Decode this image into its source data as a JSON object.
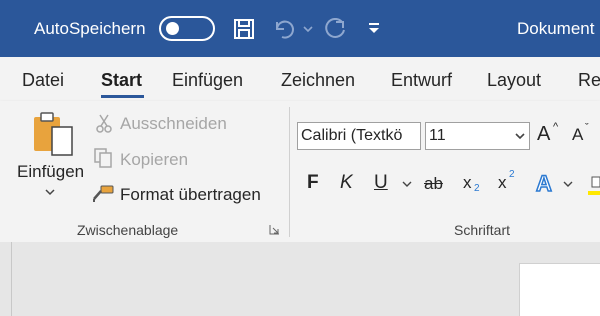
{
  "titlebar": {
    "autosave_label": "AutoSpeichern",
    "autosave_state": "off",
    "document_title": "Dokument"
  },
  "tabs": [
    {
      "label": "Datei"
    },
    {
      "label": "Start",
      "active": true
    },
    {
      "label": "Einfügen"
    },
    {
      "label": "Zeichnen"
    },
    {
      "label": "Entwurf"
    },
    {
      "label": "Layout"
    },
    {
      "label": "Re"
    }
  ],
  "clipboard": {
    "paste_label": "Einfügen",
    "cut_label": "Ausschneiden",
    "copy_label": "Kopieren",
    "format_painter_label": "Format übertragen",
    "group_label": "Zwischenablage"
  },
  "font": {
    "font_name": "Calibri (Textkö",
    "font_size": "11",
    "bold_glyph": "F",
    "italic_glyph": "K",
    "underline_glyph": "U",
    "strike_glyph": "ab",
    "subscript_glyph": "x",
    "subscript_mark": "2",
    "superscript_glyph": "x",
    "superscript_mark": "2",
    "grow_glyph": "A",
    "shrink_glyph": "A",
    "effects_glyph": "A",
    "group_label": "Schriftart"
  },
  "colors": {
    "titlebar": "#2b579a",
    "ribbon": "#f3f3f3",
    "accent": "#2b579a",
    "paste_icon": "#e8a33d",
    "text_effects": "#2b79d1"
  }
}
